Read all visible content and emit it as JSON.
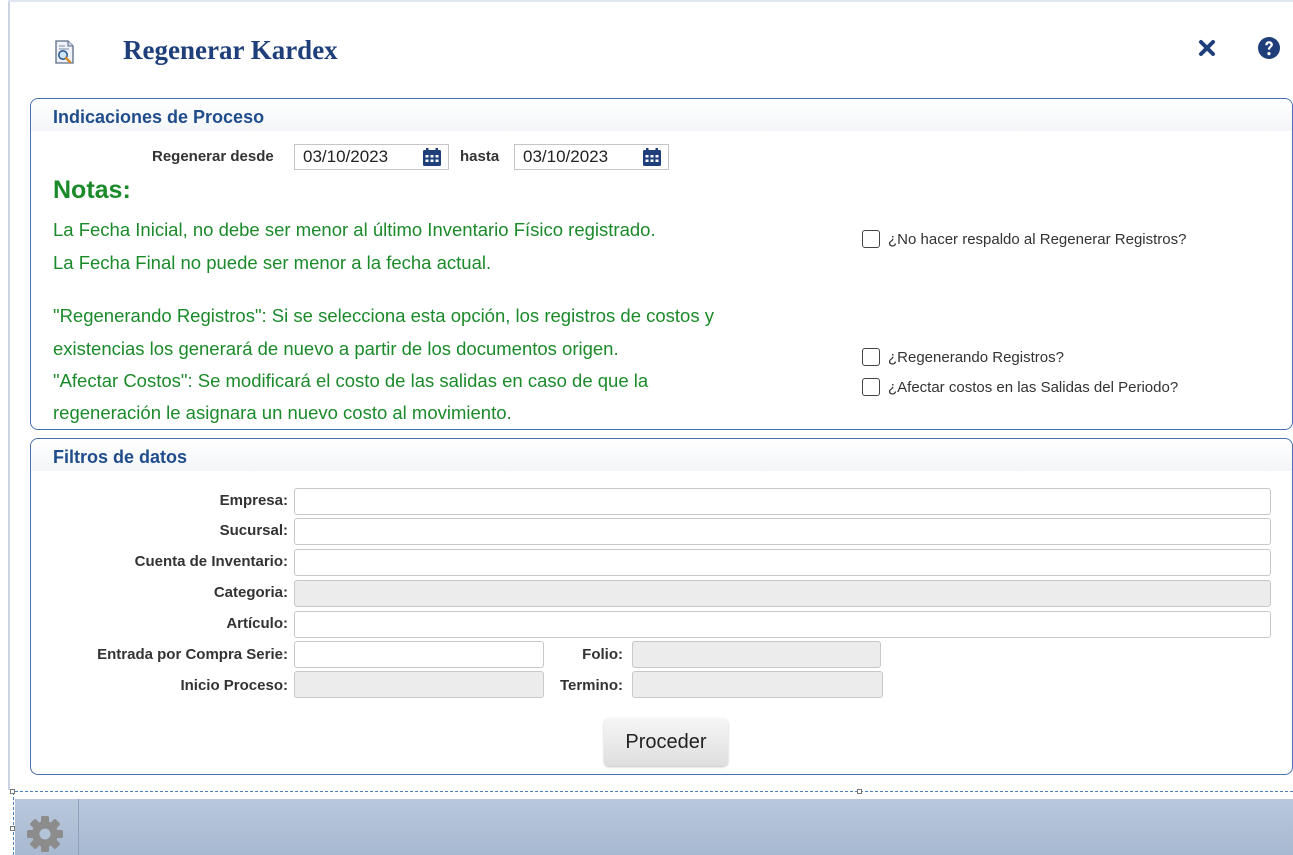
{
  "window": {
    "title": "Regenerar Kardex",
    "icon": "report-search-icon",
    "close_icon": "close-icon",
    "help_icon": "help-icon"
  },
  "process_panel": {
    "title": "Indicaciones de Proceso",
    "from_label": "Regenerar desde",
    "from_value": "03/10/2023",
    "to_label": "hasta",
    "to_value": "03/10/2023",
    "notes_heading": "Notas:",
    "notes": [
      "La Fecha Inicial, no debe ser menor al último Inventario Físico registrado.",
      "La Fecha Final no puede ser menor a la fecha actual.",
      "\"Regenerando Registros\": Si se selecciona esta opción, los registros de costos y",
      "existencias los generará de nuevo a partir de los documentos origen.",
      "\"Afectar Costos\": Se modificará el costo de las salidas en caso de que la",
      "regeneración le asignara un nuevo costo al movimiento."
    ],
    "options": [
      {
        "label": "¿No hacer respaldo al Regenerar Registros?",
        "checked": false
      },
      {
        "label": "¿Regenerando Registros?",
        "checked": false
      },
      {
        "label": "¿Afectar costos en las Salidas del Periodo?",
        "checked": false
      }
    ]
  },
  "filters_panel": {
    "title": "Filtros de datos",
    "empresa_label": "Empresa:",
    "empresa_value": "",
    "sucursal_label": "Sucursal:",
    "sucursal_value": "",
    "cuenta_label": "Cuenta de Inventario:",
    "cuenta_value": "",
    "categoria_label": "Categoria:",
    "categoria_value": "",
    "articulo_label": "Artículo:",
    "articulo_value": "",
    "serie_label": "Entrada por Compra Serie:",
    "serie_value": "",
    "folio_label": "Folio:",
    "folio_value": "",
    "inicio_label": "Inicio Proceso:",
    "inicio_value": "",
    "termino_label": "Termino:",
    "termino_value": "",
    "proceed_label": "Proceder"
  },
  "colors": {
    "title": "#1f3f7a",
    "panel_border": "#4a72b0",
    "notes": "#1b8a2a",
    "footer": "#b0c1d6"
  },
  "footer": {
    "settings_icon": "gear-icon"
  }
}
